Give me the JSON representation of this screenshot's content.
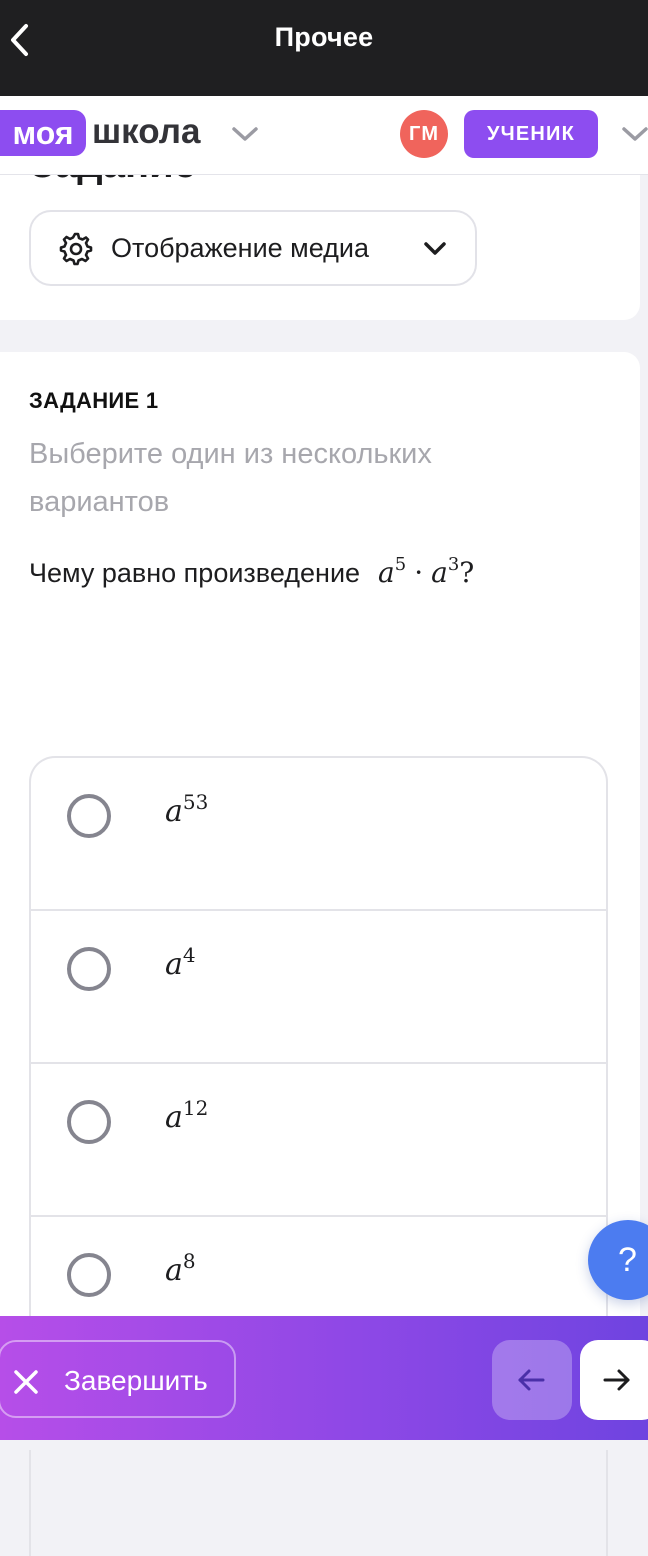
{
  "topbar": {
    "title": "Прочее",
    "back_icon": "chevron-left-icon"
  },
  "header": {
    "logo_part1": "моя",
    "logo_part2": "школа",
    "avatar_initials": "ГМ",
    "role": "УЧЕНИК",
    "colors": {
      "brand": "#8d4df0",
      "avatar": "#f0645c"
    }
  },
  "section": {
    "title": "Задание",
    "media_button": "Отображение медиа",
    "media_icon": "gear-icon"
  },
  "task": {
    "label": "ЗАДАНИЕ 1",
    "instruction": "Выберите один из нескольких вариантов",
    "question_text": "Чему равно произведение",
    "expr": {
      "base1": "a",
      "exp1": "5",
      "op": "·",
      "base2": "a",
      "exp2": "3",
      "end": "?"
    }
  },
  "options": [
    {
      "base": "a",
      "exp": "53"
    },
    {
      "base": "a",
      "exp": "4"
    },
    {
      "base": "a",
      "exp": "12"
    },
    {
      "base": "a",
      "exp": "8"
    }
  ],
  "help_button": "?",
  "footer": {
    "finish_label": "Завершить",
    "finish_icon": "close-icon",
    "prev_icon": "arrow-left-icon",
    "next_icon": "arrow-right-icon"
  }
}
